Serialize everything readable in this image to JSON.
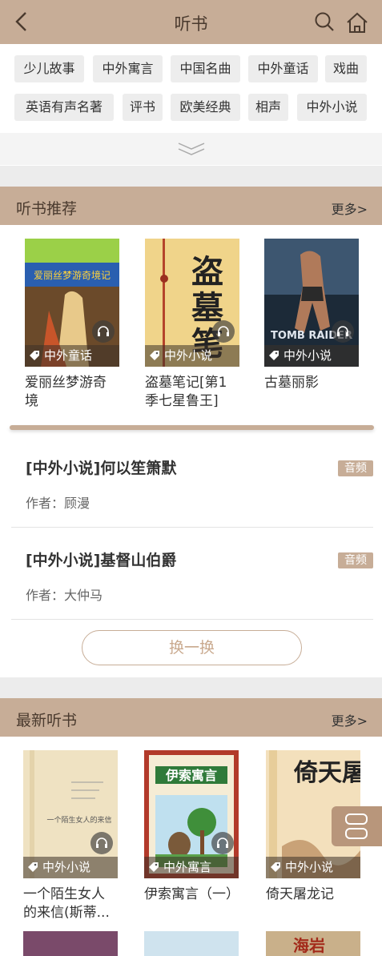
{
  "header": {
    "title": "听书"
  },
  "categories": [
    "少儿故事",
    "中外寓言",
    "中国名曲",
    "中外童话",
    "戏曲",
    "英语有声名著",
    "评书",
    "欧美经典",
    "相声",
    "中外小说"
  ],
  "recommend": {
    "title": "听书推荐",
    "more": "更多>",
    "books": [
      {
        "title": "爱丽丝梦游奇境",
        "tag": "中外童话",
        "cover_text": "爱丽丝梦游奇境记"
      },
      {
        "title": "盗墓笔记[第1季七星鲁王]",
        "tag": "中外小说",
        "cover_text": "盗墓笔"
      },
      {
        "title": "古墓丽影",
        "tag": "中外小说",
        "cover_text": "TOMB RAIDER"
      }
    ]
  },
  "list": [
    {
      "title": "[中外小说]何以笙箫默",
      "author": "作者：顾漫",
      "badge": "音频"
    },
    {
      "title": "[中外小说]基督山伯爵",
      "author": "作者：大仲马",
      "badge": "音频"
    }
  ],
  "swap_label": "换一换",
  "latest": {
    "title": "最新听书",
    "more": "更多>",
    "books": [
      {
        "title": "一个陌生女人的来信(斯蒂...",
        "tag": "中外小说",
        "cover_text": "一个陌生女人的来信"
      },
      {
        "title": "伊索寓言（一）",
        "tag": "中外寓言",
        "cover_text": "伊索寓言"
      },
      {
        "title": "倚天屠龙记",
        "tag": "中外小说",
        "cover_text": "倚天屠龙"
      }
    ],
    "partial_covers": [
      "",
      "",
      "海岩"
    ]
  },
  "colors": {
    "accent": "#c7ad97",
    "bg_gap": "#ececec",
    "chip": "#ededed"
  }
}
